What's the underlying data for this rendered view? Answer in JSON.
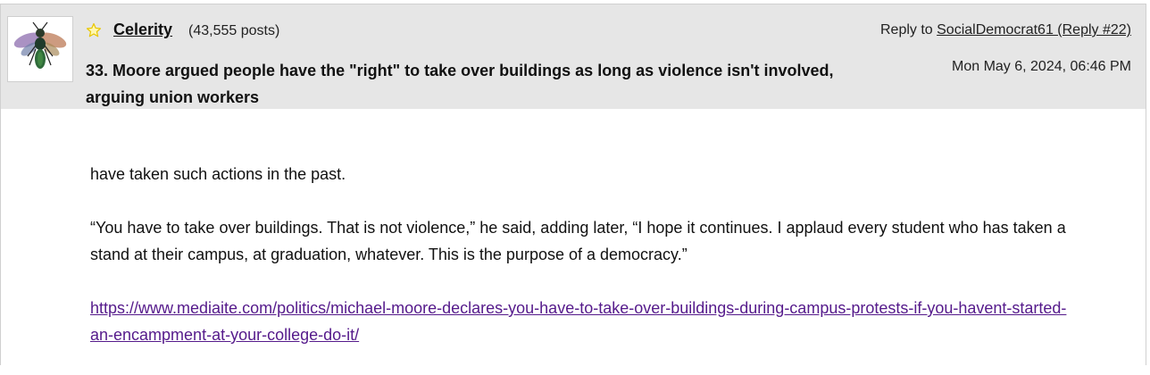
{
  "post": {
    "username": "Celerity",
    "post_count": "(43,555 posts)",
    "title": "33. Moore argued people have the \"right\" to take over buildings as long as violence isn't involved, arguing union workers",
    "reply_prefix": "Reply to ",
    "reply_link": "SocialDemocrat61 (Reply #22)",
    "timestamp": "Mon May 6, 2024, 06:46 PM",
    "avatar_icon": "wasp-icon",
    "star_icon": "star-outline-icon",
    "body": {
      "paragraph1": "have taken such actions in the past.",
      "paragraph2": "“You have to take over buildings. That is not violence,” he said, adding later, “I hope it continues. I applaud every student who has taken a stand at their campus, at graduation, whatever. This is the purpose of a democracy.”",
      "link": "https://www.mediaite.com/politics/michael-moore-declares-you-have-to-take-over-buildings-during-campus-protests-if-you-havent-started-an-encampment-at-your-college-do-it/"
    }
  },
  "colors": {
    "header_bg": "#e6e6e6",
    "link_visited": "#551a8b",
    "star": "#e8c600"
  }
}
